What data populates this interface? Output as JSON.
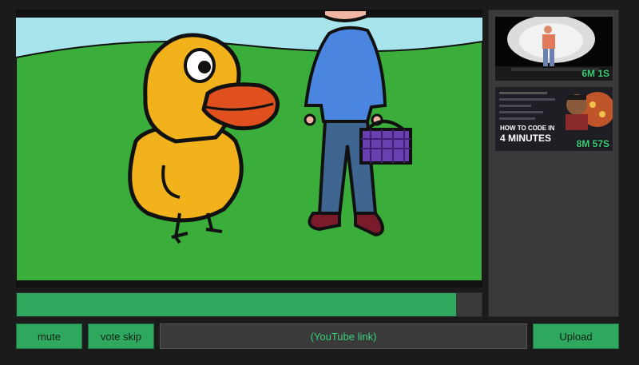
{
  "player": {
    "progress_fraction": 0.945
  },
  "queue": {
    "items": [
      {
        "duration": "6M 1S",
        "thumbnail": "stand-up-comedian-on-stage"
      },
      {
        "duration": "8M 57S",
        "thumbnail": "how-to-code-thumbnail",
        "overlay_title_1": "HOW TO CODE IN",
        "overlay_title_2": "4 MINUTES"
      }
    ]
  },
  "controls": {
    "mute_label": "mute",
    "vote_skip_label": "vote skip",
    "link_placeholder": "(YouTube link)",
    "upload_label": "Upload"
  },
  "colors": {
    "accent": "#2fa85f",
    "accent_text": "#39d17a",
    "panel": "#3a3a3a",
    "background": "#1b1b1b"
  }
}
